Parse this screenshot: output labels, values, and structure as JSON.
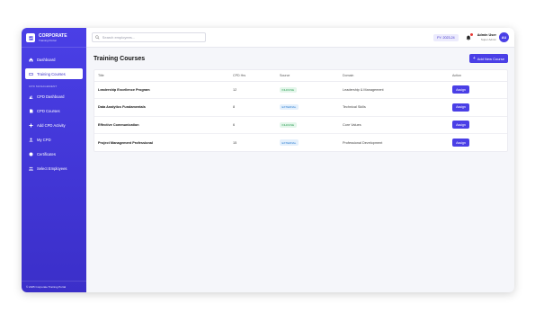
{
  "brand": {
    "title": "CORPORATE",
    "subtitle": "Training Portal"
  },
  "sidebar": {
    "items": [
      {
        "label": "Dashboard",
        "icon": "home-icon"
      },
      {
        "label": "Training Courses",
        "icon": "book-icon",
        "active": true
      }
    ],
    "section_label": "CPD MANAGEMENT",
    "section_items": [
      {
        "label": "CPD Dashboard",
        "icon": "chart-icon"
      },
      {
        "label": "CPD Courses",
        "icon": "document-icon"
      },
      {
        "label": "Add CPD Activity",
        "icon": "plus-icon"
      },
      {
        "label": "My CPD",
        "icon": "user-icon"
      },
      {
        "label": "Certificates",
        "icon": "certificate-icon"
      },
      {
        "label": "Select Employees",
        "icon": "users-icon"
      }
    ],
    "footer": "© 2025 Corporate Training Portal"
  },
  "topbar": {
    "search_placeholder": "Search employees...",
    "year_badge": "FY: 2023-24",
    "user_name": "Admin User",
    "user_role": "Super Admin",
    "avatar_initials": "AU"
  },
  "main": {
    "title": "Training Courses",
    "add_button_label": "Add New Course",
    "columns": [
      "Title",
      "CPD Hrs",
      "Source",
      "Domain",
      "Action"
    ],
    "rows": [
      {
        "title": "Leadership Excellence Program",
        "cpd": "12",
        "source": "INHOUSE",
        "source_type": "inhouse",
        "domain": "Leadership & Management",
        "action": "Assign"
      },
      {
        "title": "Data Analytics Fundamentals",
        "cpd": "8",
        "source": "EXTERNAL",
        "source_type": "external",
        "domain": "Technical Skills",
        "action": "Assign"
      },
      {
        "title": "Effective Communication",
        "cpd": "6",
        "source": "INHOUSE",
        "source_type": "inhouse",
        "domain": "Core Values",
        "action": "Assign"
      },
      {
        "title": "Project Management Professional",
        "cpd": "15",
        "source": "EXTERNAL",
        "source_type": "external",
        "domain": "Professional Development",
        "action": "Assign"
      }
    ]
  },
  "colors": {
    "accent": "#4a3fe6",
    "inhouse": "#2e9e55",
    "external": "#2a7bd0"
  }
}
